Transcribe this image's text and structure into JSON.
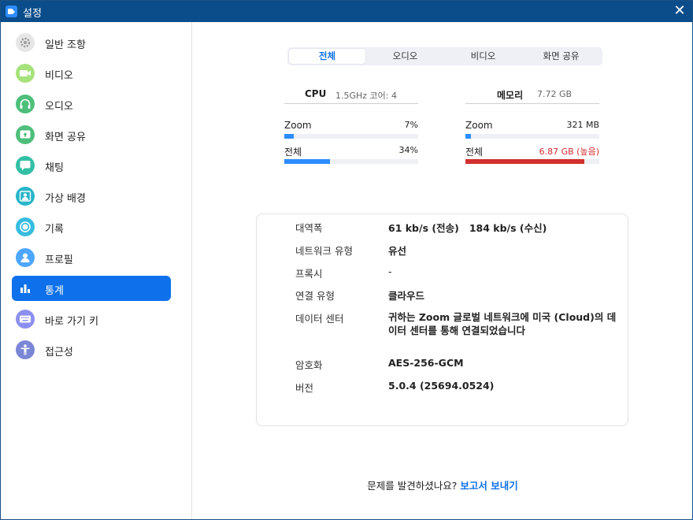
{
  "window": {
    "title": "설정",
    "close_glyph": "✕"
  },
  "sidebar": {
    "items": [
      {
        "label": "일반 조항",
        "icon": "gear-icon",
        "color": "#e6e6e6",
        "active": false
      },
      {
        "label": "비디오",
        "icon": "video-camera-icon",
        "color": "#a6e27a",
        "active": false
      },
      {
        "label": "오디오",
        "icon": "headphones-icon",
        "color": "#4dbf7a",
        "active": false
      },
      {
        "label": "화면 공유",
        "icon": "share-screen-icon",
        "color": "#4dbf7a",
        "active": false
      },
      {
        "label": "채팅",
        "icon": "chat-bubble-icon",
        "color": "#33bfa6",
        "active": false
      },
      {
        "label": "가상 배경",
        "icon": "person-background-icon",
        "color": "#26b5c9",
        "active": false
      },
      {
        "label": "기록",
        "icon": "record-icon",
        "color": "#38bde0",
        "active": false
      },
      {
        "label": "프로필",
        "icon": "profile-icon",
        "color": "#4da6ff",
        "active": false
      },
      {
        "label": "통계",
        "icon": "bar-chart-icon",
        "color": "#0e71eb",
        "active": true
      },
      {
        "label": "바로 가기 키",
        "icon": "keyboard-icon",
        "color": "#8c8ff0",
        "active": false
      },
      {
        "label": "접근성",
        "icon": "accessibility-icon",
        "color": "#7a86d6",
        "active": false
      }
    ]
  },
  "tabs": [
    {
      "label": "전체",
      "active": true
    },
    {
      "label": "오디오",
      "active": false
    },
    {
      "label": "비디오",
      "active": false
    },
    {
      "label": "화면 공유",
      "active": false
    }
  ],
  "cpu": {
    "name": "CPU",
    "detail": "1.5GHz  코어: 4",
    "zoom_label": "Zoom",
    "zoom_value": "7%",
    "zoom_fraction": 0.07,
    "total_label": "전체",
    "total_value": "34%",
    "total_fraction": 0.34
  },
  "memory": {
    "name": "메모리",
    "detail": "7.72 GB",
    "zoom_label": "Zoom",
    "zoom_value": "321 MB",
    "zoom_fraction": 0.04,
    "total_label": "전체",
    "total_value": "6.87 GB (높음)",
    "total_fraction": 0.89
  },
  "network": {
    "bandwidth_label": "대역폭",
    "bandwidth_value": "61 kb/s (전송)   184 kb/s (수신)",
    "type_label": "네트워크 유형",
    "type_value": "유선",
    "proxy_label": "프록시",
    "proxy_value": "-",
    "conn_label": "연결 유형",
    "conn_value": "클라우드",
    "dc_label": "데이터 센터",
    "dc_value": "귀하는 Zoom 글로벌 네트워크에 미국 (Cloud)의 데이터 센터를 통해 연결되었습니다",
    "enc_label": "암호화",
    "enc_value": "AES-256-GCM",
    "ver_label": "버전",
    "ver_value": "5.0.4 (25694.0524)"
  },
  "footer": {
    "question": "문제를 발견하셨나요? ",
    "link": "보고서 보내기"
  },
  "colors": {
    "accent": "#0e71eb",
    "titlebar": "#0b4d8a",
    "warning": "#d32f2f",
    "bar": "#2d8cff"
  }
}
